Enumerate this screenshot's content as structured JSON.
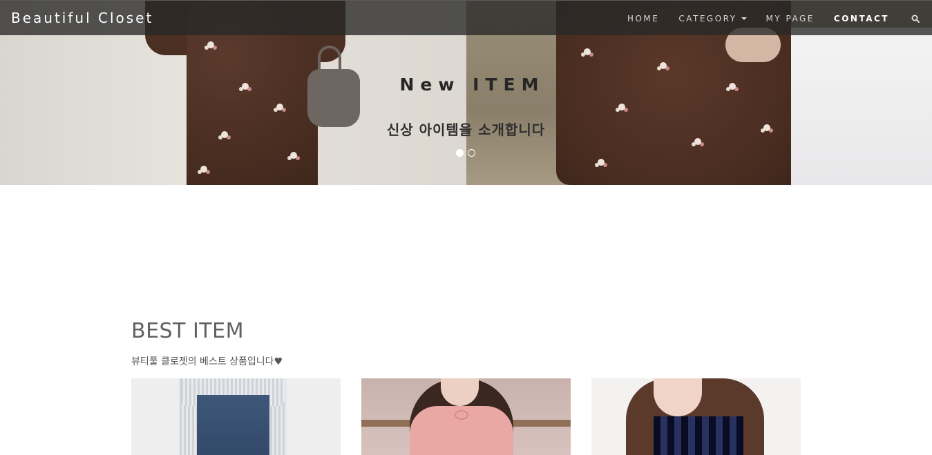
{
  "navbar": {
    "brand": "Beautiful Closet",
    "links": [
      {
        "label": "HOME"
      },
      {
        "label": "CATEGORY"
      },
      {
        "label": "MY PAGE"
      },
      {
        "label": "CONTACT"
      }
    ],
    "search_icon": "search-icon"
  },
  "hero": {
    "title": "New ITEM",
    "subtitle": "신상 아이템을 소개합니다",
    "slides_count": 2,
    "active_slide": 1
  },
  "best_section": {
    "title": "BEST ITEM",
    "subtitle": "뷰티풀 클로젯의 베스트 상품입니다",
    "heart": "♥",
    "products": [
      {
        "name": "jeans-product-image"
      },
      {
        "name": "pink-blouse-product-image"
      },
      {
        "name": "plaid-shirt-product-image"
      }
    ]
  },
  "colors": {
    "navbar_bg": "#282828",
    "nav_text": "#d6d6d6",
    "section_title": "#606060"
  }
}
